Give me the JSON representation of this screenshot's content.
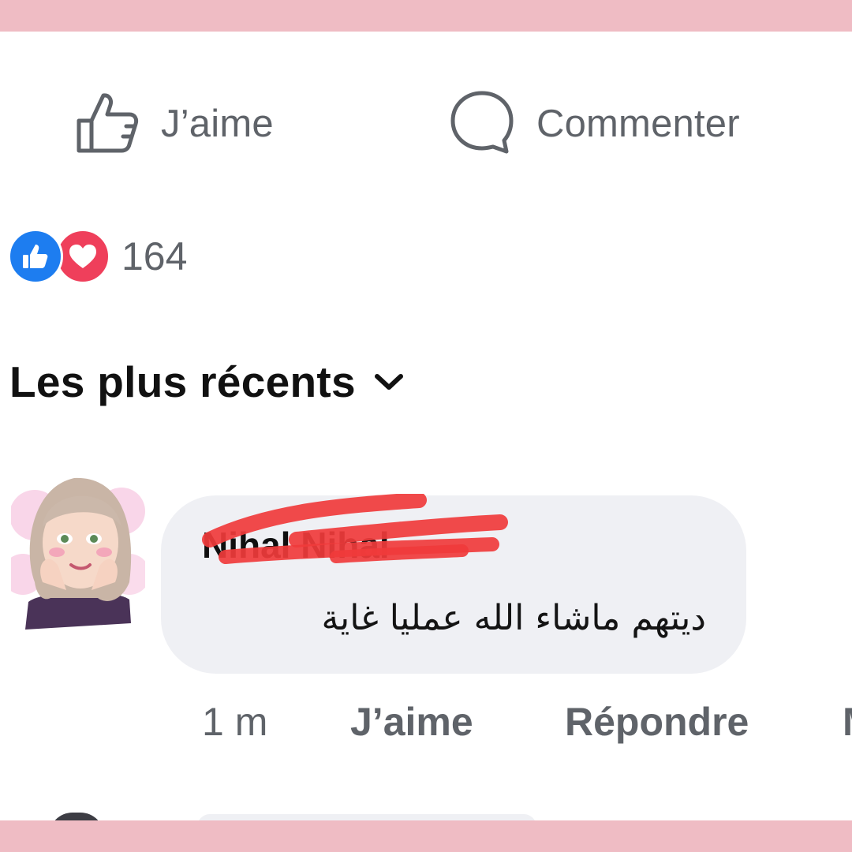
{
  "actions": {
    "like_label": "J’aime",
    "comment_label": "Commenter"
  },
  "reactions": {
    "count": "164",
    "icons": [
      "like-icon",
      "heart-icon"
    ]
  },
  "sort": {
    "label": "Les plus récents"
  },
  "comment": {
    "author": "Nihal Nihal",
    "text": "ديتهم ماشاء الله عمليا غاية",
    "time": "1 m",
    "like_label": "J’aime",
    "reply_label": "Répondre",
    "more_label": "M"
  },
  "colors": {
    "frame": "#efbcc4",
    "like_blue": "#1d7df0",
    "love_red": "#ef3f5b",
    "bubble": "#eff0f4",
    "secondary_text": "#5f6369"
  }
}
